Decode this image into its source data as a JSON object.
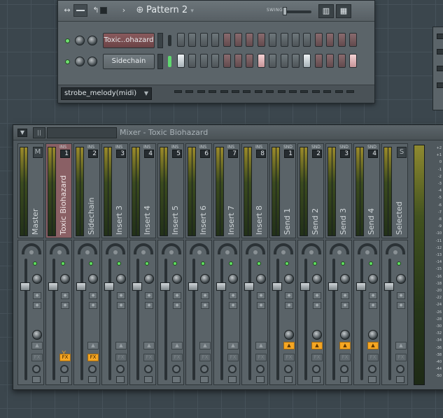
{
  "pattern": {
    "title": "Pattern 2",
    "swing_label": "SWING",
    "midi_select": "strobe_melody(midi)",
    "channels": [
      {
        "name": "Toxic..ohazard",
        "selected": true,
        "indicator_on": false,
        "steps": [
          "a",
          "a",
          "a",
          "a",
          "b",
          "b",
          "b",
          "b",
          "a",
          "a",
          "a",
          "a",
          "b",
          "b",
          "b",
          "b"
        ]
      },
      {
        "name": "Sidechain",
        "selected": false,
        "indicator_on": true,
        "steps": [
          "W",
          "a",
          "a",
          "a",
          "b",
          "b",
          "b",
          "P",
          "a",
          "a",
          "a",
          "W",
          "b",
          "b",
          "b",
          "P"
        ]
      }
    ]
  },
  "mixer": {
    "title": "Mixer - Toxic Biohazard",
    "strips": [
      {
        "label": "Master",
        "tag": "",
        "num": "",
        "master": true,
        "route": "",
        "fx": false,
        "send_knob": true
      },
      {
        "label": "Toxic Biohazard",
        "tag": "INS",
        "num": "1",
        "selected": true,
        "route": "",
        "fx": true,
        "send_knob": false
      },
      {
        "label": "Sidechain",
        "tag": "INS",
        "num": "2",
        "route": "",
        "fx": true,
        "send_knob": false
      },
      {
        "label": "Insert 3",
        "tag": "INS",
        "num": "3",
        "route": "",
        "fx": false,
        "send_knob": false
      },
      {
        "label": "Insert 4",
        "tag": "INS",
        "num": "4",
        "route": "",
        "fx": false,
        "send_knob": false
      },
      {
        "label": "Insert 5",
        "tag": "INS",
        "num": "5",
        "route": "",
        "fx": false,
        "send_knob": false
      },
      {
        "label": "Insert 6",
        "tag": "INS",
        "num": "6",
        "route": "",
        "fx": false,
        "send_knob": false
      },
      {
        "label": "Insert 7",
        "tag": "INS",
        "num": "7",
        "route": "",
        "fx": false,
        "send_knob": false
      },
      {
        "label": "Insert 8",
        "tag": "INS",
        "num": "8",
        "route": "",
        "fx": false,
        "send_knob": false
      },
      {
        "label": "Send 1",
        "tag": "SND",
        "num": "1",
        "route": "active",
        "fx": false,
        "send_knob": true
      },
      {
        "label": "Send 2",
        "tag": "SND",
        "num": "2",
        "route": "active",
        "fx": false,
        "send_knob": true
      },
      {
        "label": "Send 3",
        "tag": "SND",
        "num": "3",
        "route": "active",
        "fx": false,
        "send_knob": true
      },
      {
        "label": "Send 4",
        "tag": "SND",
        "num": "4",
        "route": "active",
        "fx": false,
        "send_knob": true
      },
      {
        "label": "Selected",
        "tag": "",
        "num": "",
        "selected_icon": true,
        "route": "",
        "fx": false,
        "send_knob": false
      }
    ],
    "scale": [
      "+2",
      "+1",
      "0",
      "-1",
      "-2",
      "-3",
      "-4",
      "-5",
      "-6",
      "-7",
      "-8",
      "-9",
      "-10",
      "-11",
      "-12",
      "-13",
      "-14",
      "-15",
      "-16",
      "-18",
      "-20",
      "-22",
      "-24",
      "-26",
      "-28",
      "-30",
      "-32",
      "-34",
      "-36",
      "-38",
      "-40",
      "-44",
      "-50"
    ],
    "fx_label": "FX"
  }
}
